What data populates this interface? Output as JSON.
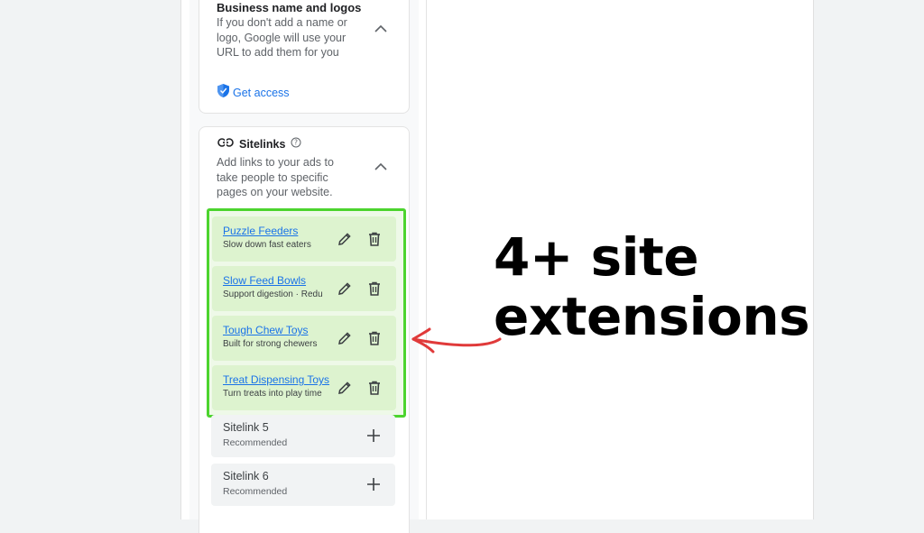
{
  "business": {
    "title": "Business name and logos",
    "description": "If you don't add a name or logo, Google will use your URL to add them for you",
    "get_access": "Get access"
  },
  "sitelinks": {
    "title": "Sitelinks",
    "description": "Add links to your ads to take people to specific pages on your website.",
    "items": [
      {
        "name": "Puzzle Feeders",
        "desc": "Slow down fast eaters"
      },
      {
        "name": "Slow Feed Bowls",
        "desc": "Support digestion · Reduce bloat"
      },
      {
        "name": "Tough Chew Toys",
        "desc": "Built for strong chewers"
      },
      {
        "name": "Treat Dispensing Toys",
        "desc": "Turn treats into play time"
      }
    ],
    "empty": [
      {
        "name": "Sitelink 5",
        "sub": "Recommended"
      },
      {
        "name": "Sitelink 6",
        "sub": "Recommended"
      }
    ]
  },
  "callout": {
    "line1": "4+ site",
    "line2": "extensions"
  },
  "colors": {
    "highlight": "#4cd42e",
    "link": "#1a73e8",
    "arrow": "#e03a3a"
  }
}
